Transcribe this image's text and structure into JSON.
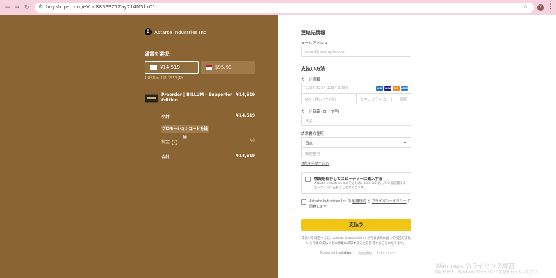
{
  "browser": {
    "url": "buy.stripe.com/eVqdR83P9Z7Zay714M5kk01",
    "profile_initial": "Y"
  },
  "left": {
    "merchant_logo": "B",
    "merchant_name": "Astarte Industries Inc",
    "currency_title": "通貨を選択:",
    "currency_jpy": "¥14,519",
    "currency_usd": "$95.99",
    "exchange_rate": "1 USD = 151.2553 JPY",
    "item_name": "Preorder | BILLUM - Supporter Edition",
    "item_price": "¥14,519",
    "subtotal_label": "小計",
    "subtotal_value": "¥14,519",
    "promo_label": "プロモーションコードを追加",
    "tax_label": "税金",
    "tax_value": "¥0",
    "total_label": "合計",
    "total_value": "¥14,519"
  },
  "right": {
    "contact_title": "連絡先情報",
    "email_label": "メールアドレス",
    "email_placeholder": "email@example.com",
    "payment_title": "支払い方法",
    "card_label": "カード情報",
    "card_number_placeholder": "1234 1234 1234 1234",
    "card_brands": [
      "JCB",
      "VISA",
      "MC",
      "AMEX"
    ],
    "expiry_placeholder": "MM (月) / YY (年)",
    "cvc_placeholder": "セキュリティコード",
    "name_label": "カード名義 (ローマ字)",
    "name_placeholder": "氏名",
    "address_label": "請求書の住所",
    "country_value": "日本",
    "postal_placeholder": "郵便番号",
    "manual_address_link": "住所を手動で入力",
    "save_title": "情報を保存してスピーディーに購入する",
    "save_desc": "Astarte Industries Inc をはじめ、Link に対応している店舗でスピーディーに支払うことができます。",
    "terms_text_1": "Astarte Industries Inc の",
    "terms_link_1": "利用規約",
    "terms_text_2": "と",
    "terms_link_2": "プライバシーポリシー",
    "terms_text_3": "に同意します",
    "pay_button": "支払う",
    "fine_print": "支払いを確定すると、Astarte Industries Inc が今後規約に従って今回の支払いと今後の支払いを本事業に請求することを許可することになります。",
    "powered_by": "Powered by",
    "stripe": "stripe",
    "footer_terms": "利用規約",
    "footer_privacy": "プライバシー"
  },
  "watermark": {
    "line1": "Windows のライセンス認証",
    "line2": "設定を開き、Windows のライセンス認証を行ってください。"
  },
  "colors": {
    "left_panel": "#8b6433",
    "pay_button": "#f1c514",
    "browser_bar": "#f6d3df"
  }
}
